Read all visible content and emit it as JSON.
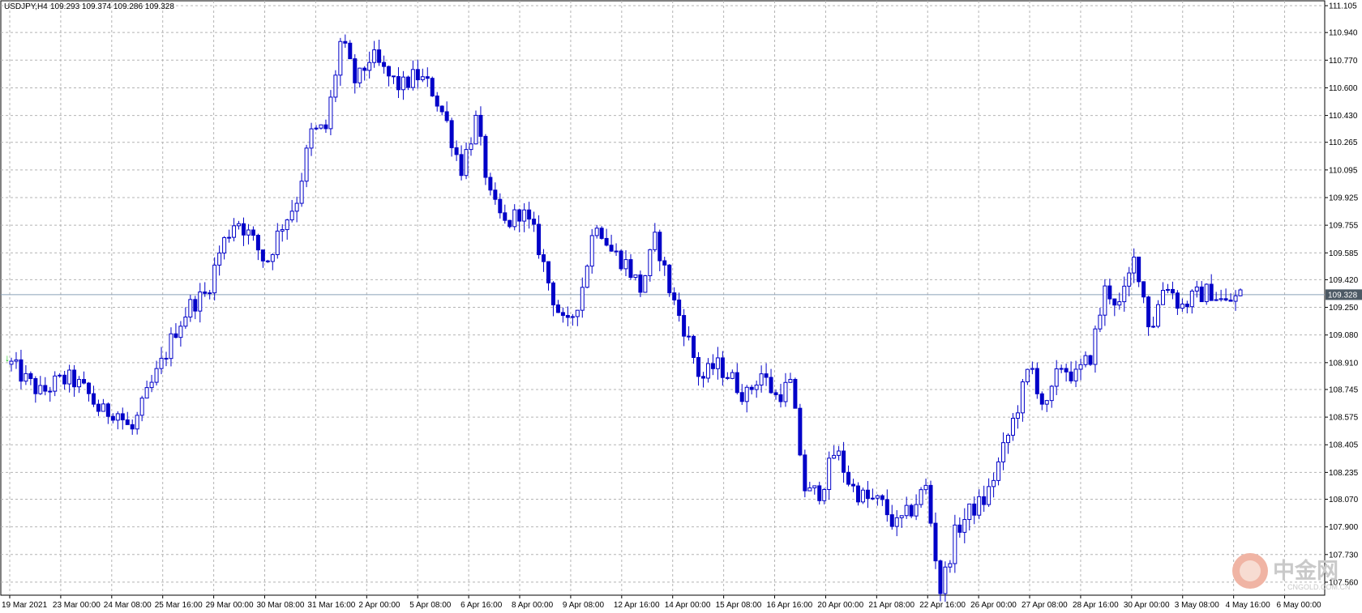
{
  "header": {
    "symbol": "USDJPY,H4",
    "ohlc": "109.293 109.374 109.286 109.328"
  },
  "watermark": {
    "logo_text": "中金网",
    "sub_text": "CNGOLD.COM.CN"
  },
  "colors": {
    "background": "#ffffff",
    "grid": "#b4b4b4",
    "candle": "#0000c8",
    "price_line": "#8aa0b8",
    "last_price_tag": "#4c5964",
    "first_tick": "#00c000"
  },
  "chart_data": {
    "type": "candlestick",
    "symbol": "USDJPY",
    "timeframe": "H4",
    "grid": true,
    "y_ticks": [
      "111.105",
      "110.940",
      "110.770",
      "110.600",
      "110.430",
      "110.265",
      "110.095",
      "109.925",
      "109.755",
      "109.585",
      "109.420",
      "109.250",
      "109.080",
      "108.910",
      "108.745",
      "108.575",
      "108.405",
      "108.235",
      "108.070",
      "107.900",
      "107.730",
      "107.560"
    ],
    "ylim": [
      107.48,
      111.135
    ],
    "last_price": "109.328",
    "x_labels": [
      "19 Mar 2021",
      "23 Mar 00:00",
      "24 Mar 08:00",
      "25 Mar 16:00",
      "29 Mar 00:00",
      "30 Mar 08:00",
      "31 Mar 16:00",
      "2 Apr 00:00",
      "5 Apr 08:00",
      "6 Apr 16:00",
      "8 Apr 00:00",
      "9 Apr 08:00",
      "12 Apr 16:00",
      "14 Apr 00:00",
      "15 Apr 08:00",
      "16 Apr 16:00",
      "20 Apr 00:00",
      "21 Apr 08:00",
      "22 Apr 16:00",
      "26 Apr 00:00",
      "27 Apr 08:00",
      "28 Apr 16:00",
      "30 Apr 00:00",
      "3 May 08:00",
      "4 May 16:00",
      "6 May 00:00"
    ],
    "close_path": [
      108.9,
      108.8,
      108.72,
      108.79,
      108.81,
      108.73,
      108.6,
      108.62,
      108.48,
      108.7,
      108.9,
      109.12,
      109.27,
      109.33,
      109.62,
      109.8,
      109.68,
      109.52,
      109.75,
      109.9,
      110.32,
      110.35,
      110.9,
      110.62,
      110.8,
      110.68,
      110.6,
      110.68,
      110.6,
      110.4,
      110.1,
      110.4,
      109.9,
      109.75,
      109.85,
      109.68,
      109.35,
      109.1,
      109.34,
      109.8,
      109.6,
      109.52,
      109.36,
      109.68,
      109.33,
      109.1,
      108.8,
      108.9,
      108.82,
      108.7,
      108.85,
      108.7,
      108.78,
      108.1,
      108.12,
      108.38,
      108.15,
      108.07,
      108.05,
      107.9,
      108.0,
      108.15,
      107.5,
      107.87,
      108.0,
      108.07,
      108.32,
      108.6,
      108.9,
      108.6,
      108.9,
      108.82,
      108.95,
      109.37,
      109.25,
      109.57,
      109.1,
      109.42,
      109.25,
      109.32,
      109.35,
      109.27,
      109.33
    ]
  }
}
